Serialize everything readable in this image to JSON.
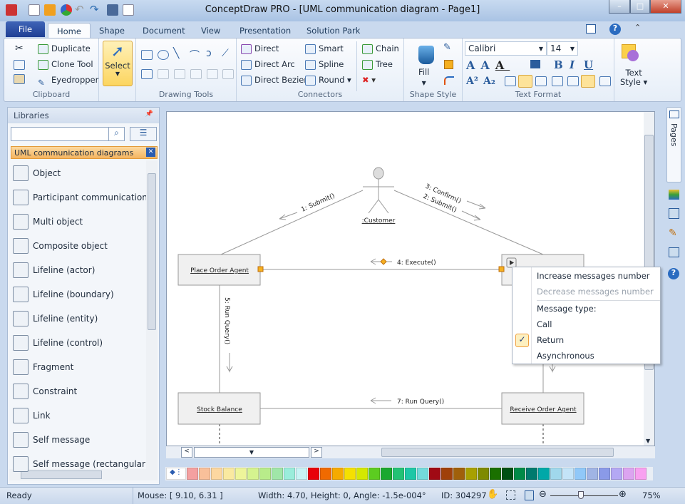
{
  "window": {
    "title": "ConceptDraw PRO - [UML communication diagram - Page1]"
  },
  "tabs": [
    "File",
    "Home",
    "Shape",
    "Document",
    "View",
    "Presentation",
    "Solution Park"
  ],
  "ribbon": {
    "clipboard": {
      "label": "Clipboard",
      "duplicate": "Duplicate",
      "clone": "Clone Tool",
      "eyedropper": "Eyedropper"
    },
    "select": {
      "label": "Select"
    },
    "drawing_tools": {
      "label": "Drawing Tools"
    },
    "connectors": {
      "label": "Connectors",
      "items": [
        "Direct",
        "Direct Arc",
        "Direct Bezier",
        "Smart",
        "Spline",
        "Round",
        "Chain",
        "Tree"
      ]
    },
    "shape_style": {
      "label": "Shape Style",
      "fill": "Fill"
    },
    "text_format": {
      "label": "Text Format",
      "font": "Calibri",
      "size": "14"
    },
    "text_style": {
      "label1": "Text",
      "label2": "Style"
    }
  },
  "libraries": {
    "title": "Libraries",
    "search_placeholder": "",
    "category": "UML communication diagrams",
    "items": [
      "Object",
      "Participant communication link",
      "Multi object",
      "Composite object",
      "Lifeline (actor)",
      "Lifeline (boundary)",
      "Lifeline (entity)",
      "Lifeline (control)",
      "Fragment",
      "Constraint",
      "Link",
      "Self message",
      "Self message (rectangular)"
    ]
  },
  "diagram": {
    "actor": ":Customer",
    "objects": {
      "place": "Place Order Agent",
      "stock": "Stock Balance",
      "receive": "Receive Order Agent"
    },
    "messages": {
      "m1": "1: Submit()",
      "m2": "2: Submit()",
      "m3": "3: Confirm()",
      "m4": "4: Execute()",
      "m5": "5: Run Query()",
      "m7": "7: Run Query()"
    }
  },
  "context_menu": {
    "increase": "Increase messages number",
    "decrease": "Decrease messages number",
    "type_header": "Message type:",
    "call": "Call",
    "return": "Return",
    "async": "Asynchronous",
    "checked": "Return"
  },
  "right_panel": {
    "pages": "Pages"
  },
  "palette": [
    "#f4a0a0",
    "#f9c09a",
    "#fcd7a0",
    "#fae9a0",
    "#eef59a",
    "#d5f38f",
    "#b8ec8a",
    "#a0e6a8",
    "#9aeddb",
    "#c8f3f5",
    "#e8000a",
    "#f06a00",
    "#f6aa00",
    "#f5e000",
    "#d4e800",
    "#5ccc20",
    "#1aa830",
    "#23c275",
    "#1ec7a6",
    "#73dadb",
    "#a00a14",
    "#a0400a",
    "#a0600a",
    "#a8a000",
    "#7e8a00",
    "#1a7000",
    "#005014",
    "#008a48",
    "#007a6e",
    "#00a8a8",
    "#a0d8ec",
    "#c4e4f8",
    "#90c8f8",
    "#a0b4e4",
    "#8a9ae8",
    "#b4a8f4",
    "#dca4f0",
    "#f8a0f0"
  ],
  "status": {
    "ready": "Ready",
    "mouse": "Mouse: [ 9.10, 6.31 ]",
    "dims": "Width: 4.70,  Height: 0,  Angle: -1.5e-004°",
    "id": "ID: 304297",
    "zoom": "75%",
    "zoom_fraction": 0.45
  }
}
